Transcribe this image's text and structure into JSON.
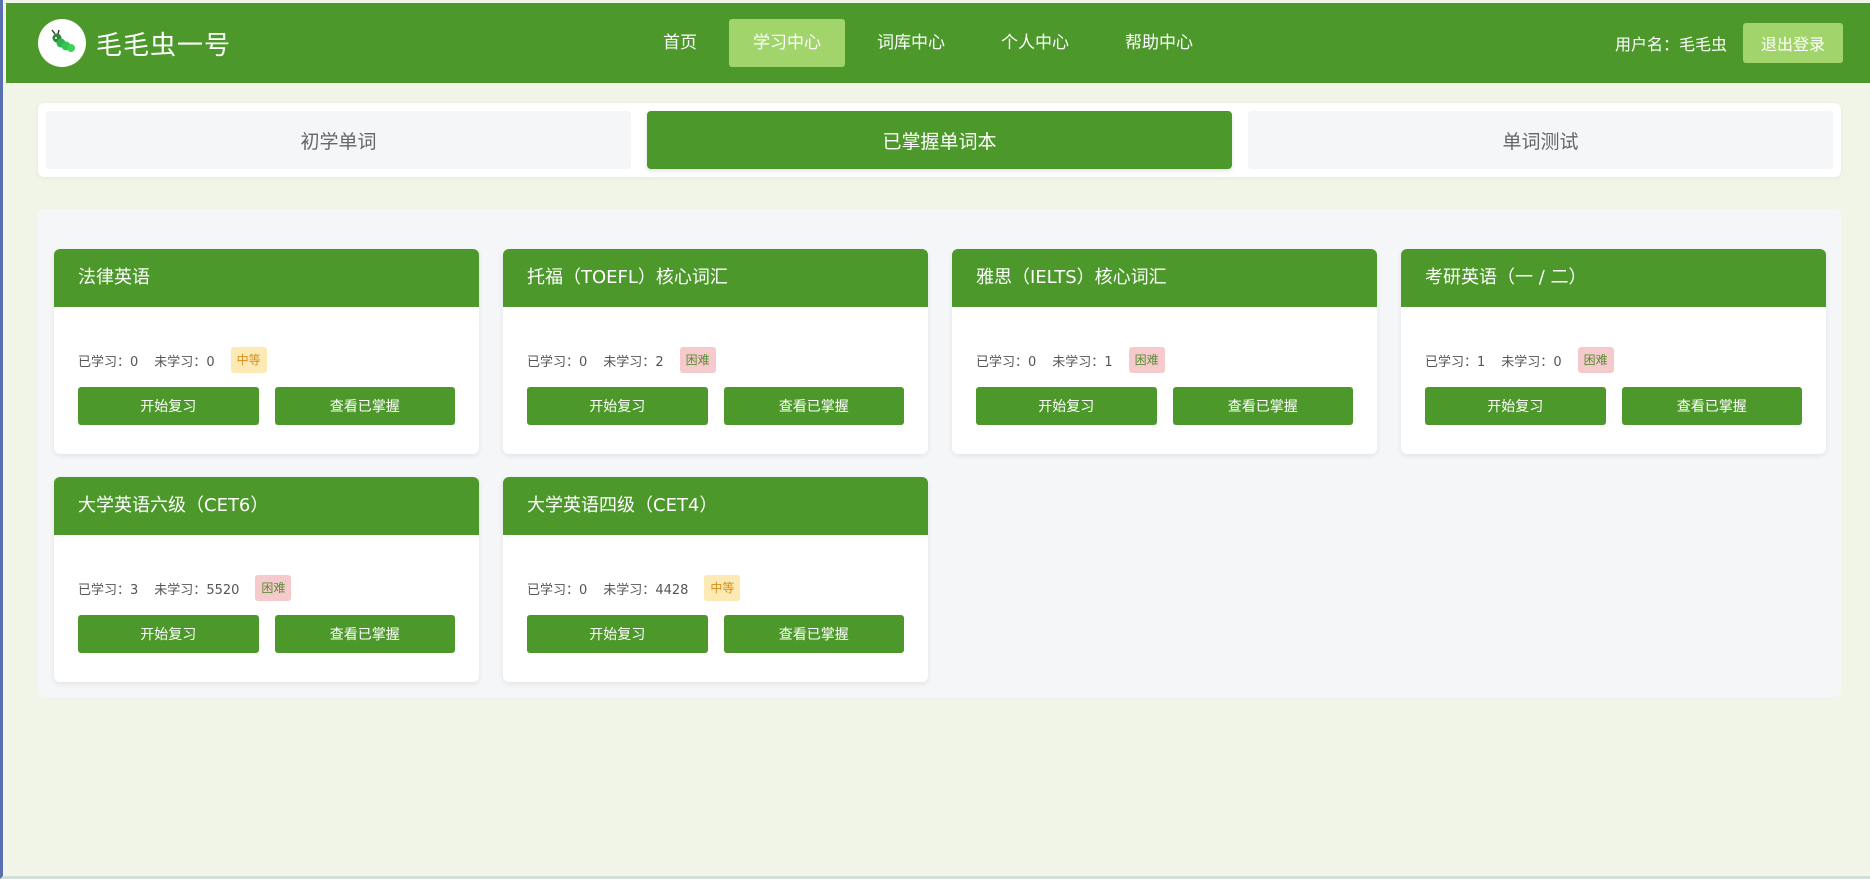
{
  "header": {
    "brand": "毛毛虫一号",
    "nav": [
      "首页",
      "学习中心",
      "词库中心",
      "个人中心",
      "帮助中心"
    ],
    "active_nav": 1,
    "user_label": "用户名：毛毛虫",
    "logout": "退出登录"
  },
  "tabs": [
    "初学单词",
    "已掌握单词本",
    "单词测试"
  ],
  "active_tab": 1,
  "labels": {
    "learned": "已学习：",
    "unlearned": "未学习：",
    "review_btn": "开始复习",
    "mastered_btn": "查看已掌握"
  },
  "cards": [
    {
      "title": "法律英语",
      "learned": "0",
      "unlearned": "0",
      "level": "中等",
      "level_type": "mid"
    },
    {
      "title": "托福（TOEFL）核心词汇",
      "learned": "0",
      "unlearned": "2",
      "level": "困难",
      "level_type": "hard"
    },
    {
      "title": "雅思（IELTS）核心词汇",
      "learned": "0",
      "unlearned": "1",
      "level": "困难",
      "level_type": "hard"
    },
    {
      "title": "考研英语（一 / 二）",
      "learned": "1",
      "unlearned": "0",
      "level": "困难",
      "level_type": "hard"
    },
    {
      "title": "大学英语六级（CET6）",
      "learned": "3",
      "unlearned": "5520",
      "level": "困难",
      "level_type": "hard"
    },
    {
      "title": "大学英语四级（CET4）",
      "learned": "0",
      "unlearned": "4428",
      "level": "中等",
      "level_type": "mid"
    }
  ],
  "colors": {
    "primary": "#4d982b",
    "accent": "#a1d46b"
  }
}
